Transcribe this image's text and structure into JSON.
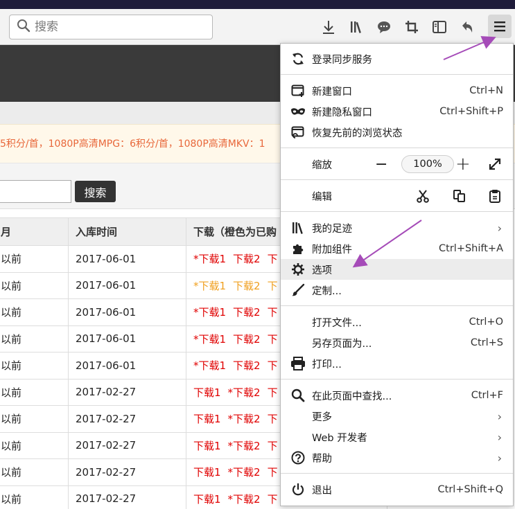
{
  "toolbar": {
    "search_placeholder": "搜索",
    "icons": [
      "download-icon",
      "library-icon",
      "chat-icon",
      "crop-icon",
      "sidebar-icon",
      "back-icon",
      "hamburger-menu-icon"
    ]
  },
  "page": {
    "notice": "5积分/首，1080P高清MPG：6积分/首，1080P高清MKV：1",
    "search_button": "搜索",
    "table": {
      "headers": [
        "月",
        "入库时间",
        "下载（橙色为已购"
      ],
      "rows": [
        {
          "c1": "以前",
          "c2": "2017-06-01",
          "links": [
            "*下载1",
            "下载2",
            "下"
          ],
          "orange": false
        },
        {
          "c1": "以前",
          "c2": "2017-06-01",
          "links": [
            "*下载1",
            "下载2",
            "下"
          ],
          "orange": true
        },
        {
          "c1": "以前",
          "c2": "2017-06-01",
          "links": [
            "*下载1",
            "下载2",
            "下"
          ],
          "orange": false
        },
        {
          "c1": "以前",
          "c2": "2017-06-01",
          "links": [
            "*下载1",
            "下载2",
            "下"
          ],
          "orange": false
        },
        {
          "c1": "以前",
          "c2": "2017-06-01",
          "links": [
            "*下载1",
            "下载2",
            "下"
          ],
          "orange": false
        },
        {
          "c1": "以前",
          "c2": "2017-02-27",
          "links": [
            "下载1",
            "*下载2",
            "下"
          ],
          "orange": false
        },
        {
          "c1": "以前",
          "c2": "2017-02-27",
          "links": [
            "下载1",
            "*下载2",
            "下"
          ],
          "orange": false
        },
        {
          "c1": "以前",
          "c2": "2017-02-27",
          "links": [
            "下载1",
            "*下载2",
            "下"
          ],
          "orange": false
        },
        {
          "c1": "以前",
          "c2": "2017-02-27",
          "links": [
            "下载1",
            "*下载2",
            "下"
          ],
          "orange": false
        },
        {
          "c1": "以前",
          "c2": "2017-02-27",
          "links": [
            "下载1",
            "*下载2",
            "下"
          ],
          "orange": false
        }
      ]
    }
  },
  "menu": {
    "sync": "登录同步服务",
    "new_window": "新建窗口",
    "new_window_sc": "Ctrl+N",
    "new_private": "新建隐私窗口",
    "new_private_sc": "Ctrl+Shift+P",
    "restore": "恢复先前的浏览状态",
    "zoom_label": "缩放",
    "zoom_minus": "−",
    "zoom_value": "100%",
    "zoom_plus": "+",
    "edit_label": "编辑",
    "library": "我的足迹",
    "addons": "附加组件",
    "addons_sc": "Ctrl+Shift+A",
    "options": "选项",
    "customize": "定制...",
    "open_file": "打开文件...",
    "open_file_sc": "Ctrl+O",
    "save_as": "另存页面为...",
    "save_as_sc": "Ctrl+S",
    "print": "打印...",
    "find": "在此页面中查找...",
    "find_sc": "Ctrl+F",
    "more": "更多",
    "web_dev": "Web 开发者",
    "help": "帮助",
    "quit": "退出",
    "quit_sc": "Ctrl+Shift+Q"
  },
  "colors": {
    "accent_arrow": "#a54bb8",
    "download_red": "#e00000",
    "download_orange": "#f0a020",
    "notice_text": "#e8673a"
  }
}
